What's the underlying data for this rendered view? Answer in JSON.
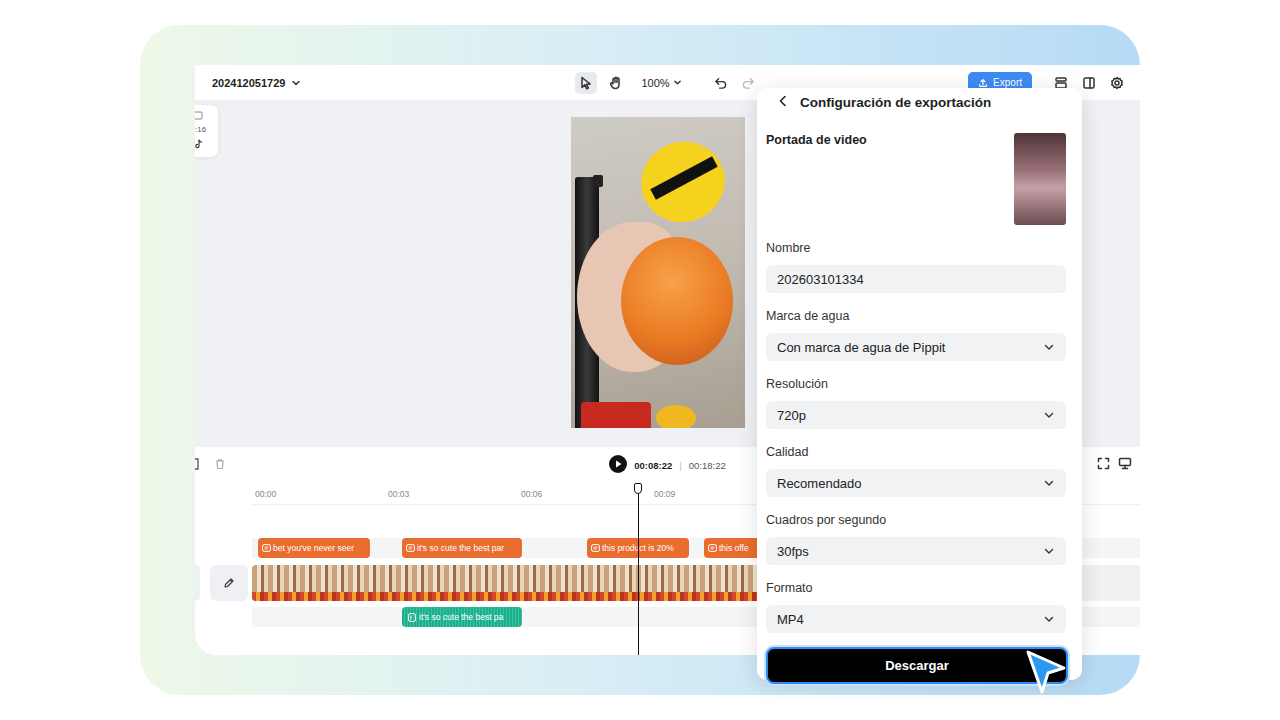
{
  "project": {
    "title": "202412051729"
  },
  "toolbar": {
    "tools": [
      {
        "kind": "pointer",
        "selected": true
      },
      {
        "kind": "hand",
        "selected": false
      }
    ],
    "zoom": "100%"
  },
  "export_button": {
    "label": "Export"
  },
  "side_card": {
    "text": ":16"
  },
  "player": {
    "current": "00:08:22",
    "separator": "|",
    "total": "00:18:22",
    "level": 0.466
  },
  "ruler": [
    "00:00",
    "00:03",
    "00:06",
    "00:09"
  ],
  "captions": [
    "bet you've never seer",
    "it's so cute the best par",
    "this product is 20%",
    "this offe"
  ],
  "audio": {
    "text": "it's so cute the best pa"
  },
  "export_panel": {
    "title": "Configuración de exportación",
    "cover_label": "Portada de video",
    "fields": [
      {
        "label": "Nombre",
        "value": "202603101334",
        "kind": "input"
      },
      {
        "label": "Marca de agua",
        "value": "Con marca de agua de Pippit",
        "kind": "select"
      },
      {
        "label": "Resolución",
        "value": "720p",
        "kind": "select"
      },
      {
        "label": "Calidad",
        "value": "Recomendado",
        "kind": "select"
      },
      {
        "label": "Cuadros por segundo",
        "value": "30fps",
        "kind": "select"
      },
      {
        "label": "Formato",
        "value": "MP4",
        "kind": "select"
      }
    ],
    "download": "Descargar"
  }
}
